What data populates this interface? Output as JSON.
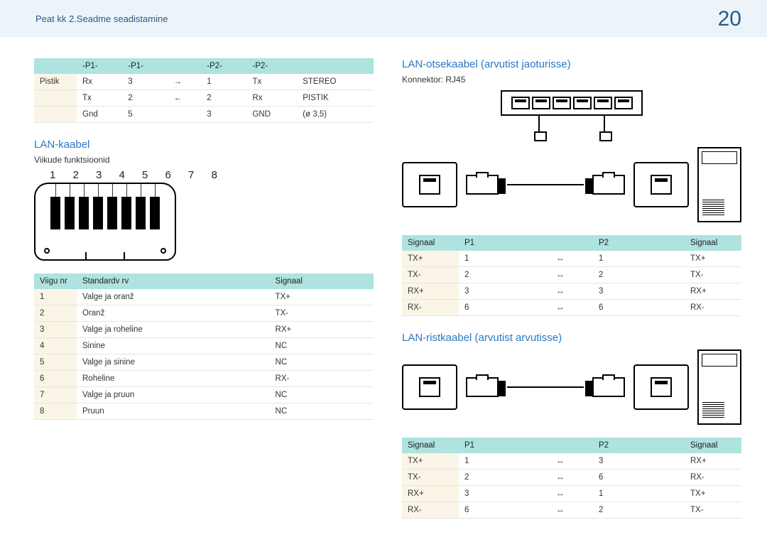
{
  "header": {
    "breadcrumb": "Peat kk 2.Seadme seadistamine",
    "page": "20"
  },
  "left": {
    "pinout_headers": [
      "-P1-",
      "-P1-",
      "",
      "-P2-",
      "-P2-"
    ],
    "pinout_rows": [
      {
        "label": "Pistik",
        "a": "Rx",
        "n1": "3",
        "arr": "→",
        "n2": "1",
        "b": "Tx",
        "c": "STEREO"
      },
      {
        "label": "",
        "a": "Tx",
        "n1": "2",
        "arr": "←",
        "n2": "2",
        "b": "Rx",
        "c": "PISTIK"
      },
      {
        "label": "",
        "a": "Gnd",
        "n1": "5",
        "arr": "",
        "n2": "3",
        "b": "GND",
        "c": "(ø 3,5)"
      }
    ],
    "lan_title": "LAN-kaabel",
    "lan_subtitle": "Viikude funktsioonid",
    "rj45_nums": "1 2 3 4 5 6 7 8",
    "func_headers": {
      "a": "Viigu nr",
      "b": "Standardv rv",
      "c": "Signaal"
    },
    "func_rows": [
      {
        "n": "1",
        "color": "Valge ja oranž",
        "sig": "TX+"
      },
      {
        "n": "2",
        "color": "Oranž",
        "sig": "TX-"
      },
      {
        "n": "3",
        "color": "Valge ja roheline",
        "sig": "RX+"
      },
      {
        "n": "4",
        "color": "Sinine",
        "sig": "NC"
      },
      {
        "n": "5",
        "color": "Valge ja sinine",
        "sig": "NC"
      },
      {
        "n": "6",
        "color": "Roheline",
        "sig": "RX-"
      },
      {
        "n": "7",
        "color": "Valge ja pruun",
        "sig": "NC"
      },
      {
        "n": "8",
        "color": "Pruun",
        "sig": "NC"
      }
    ]
  },
  "right": {
    "direct_title": "LAN-otsekaabel (arvutist jaoturisse)",
    "connector_label": "Konnektor: RJ45",
    "sig_headers": {
      "a": "Signaal",
      "b": "P1",
      "c": "P2",
      "d": "Signaal"
    },
    "direct_rows": [
      {
        "s1": "TX+",
        "p1": "1",
        "p2": "1",
        "s2": "TX+"
      },
      {
        "s1": "TX-",
        "p1": "2",
        "p2": "2",
        "s2": "TX-"
      },
      {
        "s1": "RX+",
        "p1": "3",
        "p2": "3",
        "s2": "RX+"
      },
      {
        "s1": "RX-",
        "p1": "6",
        "p2": "6",
        "s2": "RX-"
      }
    ],
    "cross_title": "LAN-ristkaabel (arvutist arvutisse)",
    "cross_rows": [
      {
        "s1": "TX+",
        "p1": "1",
        "p2": "3",
        "s2": "RX+"
      },
      {
        "s1": "TX-",
        "p1": "2",
        "p2": "6",
        "s2": "RX-"
      },
      {
        "s1": "RX+",
        "p1": "3",
        "p2": "1",
        "s2": "TX+"
      },
      {
        "s1": "RX-",
        "p1": "6",
        "p2": "2",
        "s2": "TX-"
      }
    ]
  }
}
